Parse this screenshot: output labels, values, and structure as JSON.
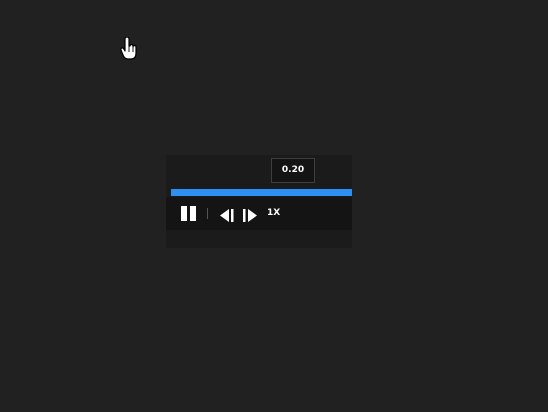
{
  "player": {
    "tooltip_value": "0.20",
    "progress_fraction": 1.0,
    "speed_label": "1X",
    "accent_color": "#2f8ef2"
  },
  "controls": {
    "pause_icon": "pause-icon",
    "prev_icon": "step-backward-icon",
    "next_icon": "step-forward-icon"
  },
  "cursor_icon": "hand-pointer-icon"
}
